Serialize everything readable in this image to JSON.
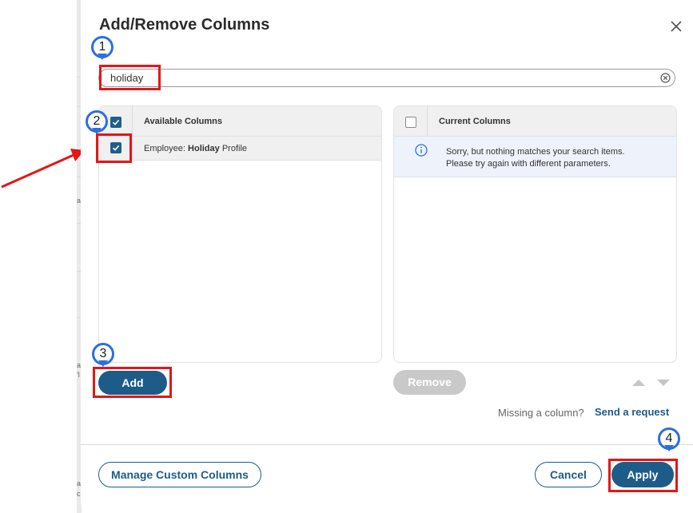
{
  "dialog": {
    "title": "Add/Remove Columns",
    "search": {
      "value": "holiday",
      "placeholder": ""
    },
    "available": {
      "header": "Available Columns",
      "items": [
        {
          "prefix": "Employee: ",
          "bold": "Holiday",
          "suffix": " Profile",
          "checked": true
        }
      ],
      "header_checked": true
    },
    "current": {
      "header": "Current Columns",
      "header_checked": false,
      "message_line1": "Sorry, but nothing matches your search items.",
      "message_line2": "Please try again with different parameters."
    },
    "buttons": {
      "add": "Add",
      "remove": "Remove",
      "manage": "Manage Custom Columns",
      "cancel": "Cancel",
      "apply": "Apply"
    },
    "missing_text": "Missing a column?",
    "send_request": "Send a request"
  },
  "annotations": {
    "markers": [
      "1",
      "2",
      "3",
      "4"
    ]
  },
  "colors": {
    "primary": "#1d5c88",
    "highlight": "#e01818",
    "marker": "#2b6fe0",
    "disabled": "#c9c9c9",
    "info_bg": "#eef3fb"
  },
  "background": {
    "edge_chars": [
      "a",
      "a",
      "'l",
      "a",
      "c"
    ]
  }
}
